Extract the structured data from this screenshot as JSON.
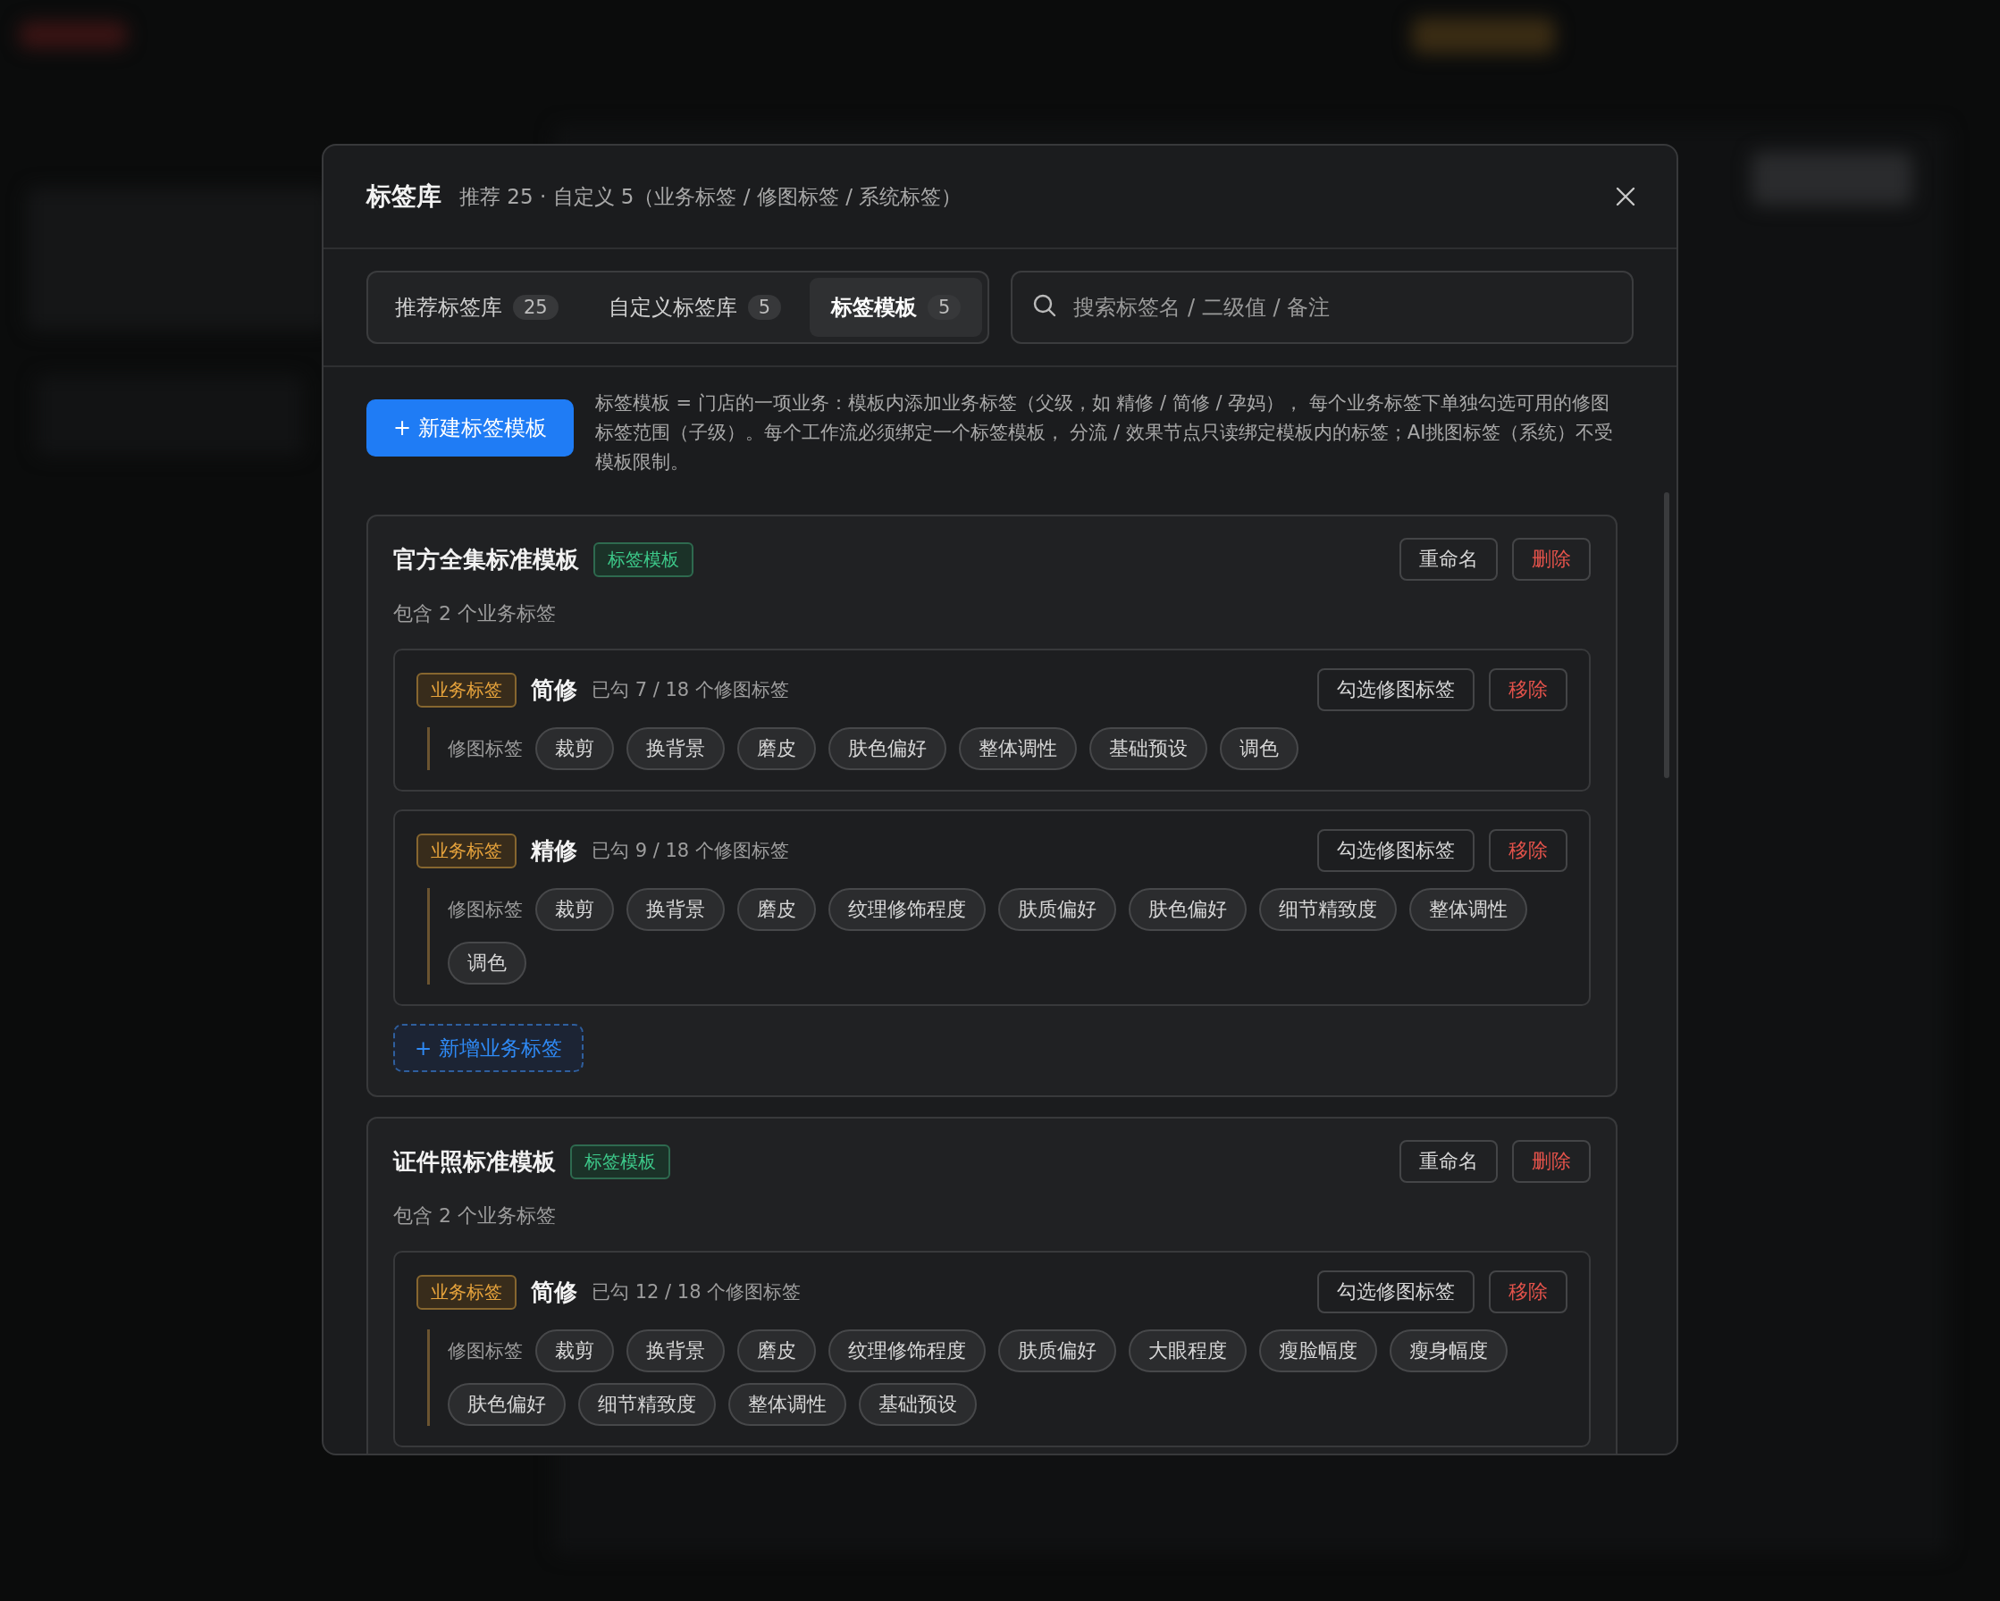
{
  "dialog": {
    "title": "标签库",
    "summary": "推荐 25 · 自定义 5（业务标签 / 修图标签 / 系统标签）"
  },
  "tabs": [
    {
      "label": "推荐标签库",
      "count": "25",
      "selected": false
    },
    {
      "label": "自定义标签库",
      "count": "5",
      "selected": false
    },
    {
      "label": "标签模板",
      "count": "5",
      "selected": true
    }
  ],
  "search": {
    "placeholder": "搜索标签名 / 二级值 / 备注"
  },
  "new_button": "+ 新建标签模板",
  "description": "标签模板 = 门店的一项业务：模板内添加业务标签（父级，如 精修 / 简修 / 孕妈）， 每个业务标签下单独勾选可用的修图标签范围（子级）。每个工作流必须绑定一个标签模板， 分流 / 效果节点只读绑定模板内的标签；AI挑图标签（系统）不受模板限制。",
  "templates": [
    {
      "name": "官方全集标准模板",
      "badge": "标签模板",
      "summary": "包含 2 个业务标签",
      "rename": "重命名",
      "delete": "删除",
      "add_button": "+ 新增业务标签",
      "business_tags": [
        {
          "badge": "业务标签",
          "name": "简修",
          "count": "已勾 7 / 18 个修图标签",
          "pick": "勾选修图标签",
          "remove": "移除",
          "retouch_label": "修图标签",
          "retouch_tags": [
            "裁剪",
            "换背景",
            "磨皮",
            "肤色偏好",
            "整体调性",
            "基础预设",
            "调色"
          ]
        },
        {
          "badge": "业务标签",
          "name": "精修",
          "count": "已勾 9 / 18 个修图标签",
          "pick": "勾选修图标签",
          "remove": "移除",
          "retouch_label": "修图标签",
          "retouch_tags": [
            "裁剪",
            "换背景",
            "磨皮",
            "纹理修饰程度",
            "肤质偏好",
            "肤色偏好",
            "细节精致度",
            "整体调性",
            "调色"
          ]
        }
      ]
    },
    {
      "name": "证件照标准模板",
      "badge": "标签模板",
      "summary": "包含 2 个业务标签",
      "rename": "重命名",
      "delete": "删除",
      "business_tags": [
        {
          "badge": "业务标签",
          "name": "简修",
          "count": "已勾 12 / 18 个修图标签",
          "pick": "勾选修图标签",
          "remove": "移除",
          "retouch_label": "修图标签",
          "retouch_tags": [
            "裁剪",
            "换背景",
            "磨皮",
            "纹理修饰程度",
            "肤质偏好",
            "大眼程度",
            "瘦脸幅度",
            "瘦身幅度",
            "肤色偏好",
            "细节精致度",
            "整体调性",
            "基础预设"
          ]
        }
      ]
    }
  ]
}
